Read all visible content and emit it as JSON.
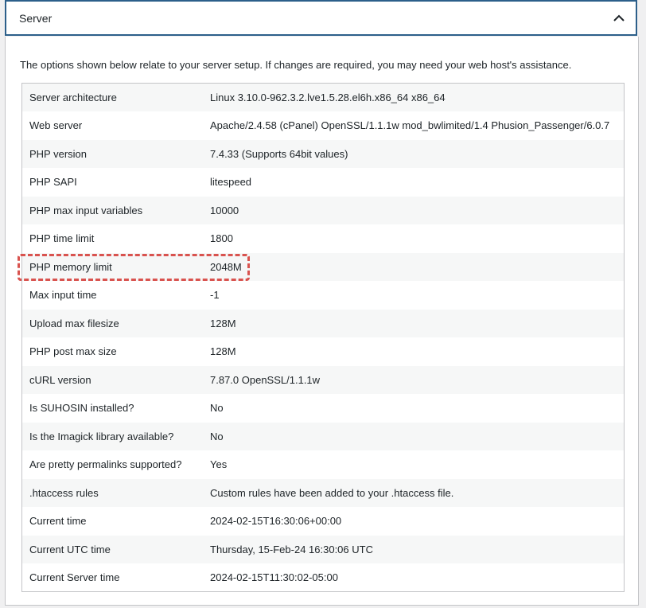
{
  "section": {
    "title": "Server",
    "toggle_icon": "chevron-up-icon"
  },
  "intro_text": "The options shown below relate to your server setup. If changes are required, you may need your web host's assistance.",
  "rows": [
    {
      "label": "Server architecture",
      "value": "Linux 3.10.0-962.3.2.lve1.5.28.el6h.x86_64 x86_64"
    },
    {
      "label": "Web server",
      "value": "Apache/2.4.58 (cPanel) OpenSSL/1.1.1w mod_bwlimited/1.4 Phusion_Passenger/6.0.7"
    },
    {
      "label": "PHP version",
      "value": "7.4.33 (Supports 64bit values)"
    },
    {
      "label": "PHP SAPI",
      "value": "litespeed"
    },
    {
      "label": "PHP max input variables",
      "value": "10000"
    },
    {
      "label": "PHP time limit",
      "value": "1800"
    },
    {
      "label": "PHP memory limit",
      "value": "2048M"
    },
    {
      "label": "Max input time",
      "value": "-1"
    },
    {
      "label": "Upload max filesize",
      "value": "128M"
    },
    {
      "label": "PHP post max size",
      "value": "128M"
    },
    {
      "label": "cURL version",
      "value": "7.87.0 OpenSSL/1.1.1w"
    },
    {
      "label": "Is SUHOSIN installed?",
      "value": "No"
    },
    {
      "label": "Is the Imagick library available?",
      "value": "No"
    },
    {
      "label": "Are pretty permalinks supported?",
      "value": "Yes"
    },
    {
      "label": ".htaccess rules",
      "value": "Custom rules have been added to your .htaccess file."
    },
    {
      "label": "Current time",
      "value": "2024-02-15T16:30:06+00:00"
    },
    {
      "label": "Current UTC time",
      "value": "Thursday, 15-Feb-24 16:30:06 UTC"
    },
    {
      "label": "Current Server time",
      "value": "2024-02-15T11:30:02-05:00"
    }
  ],
  "colors": {
    "header_border": "#2c5f8a",
    "highlight": "#d9534f",
    "row_alt": "#f6f7f7"
  }
}
